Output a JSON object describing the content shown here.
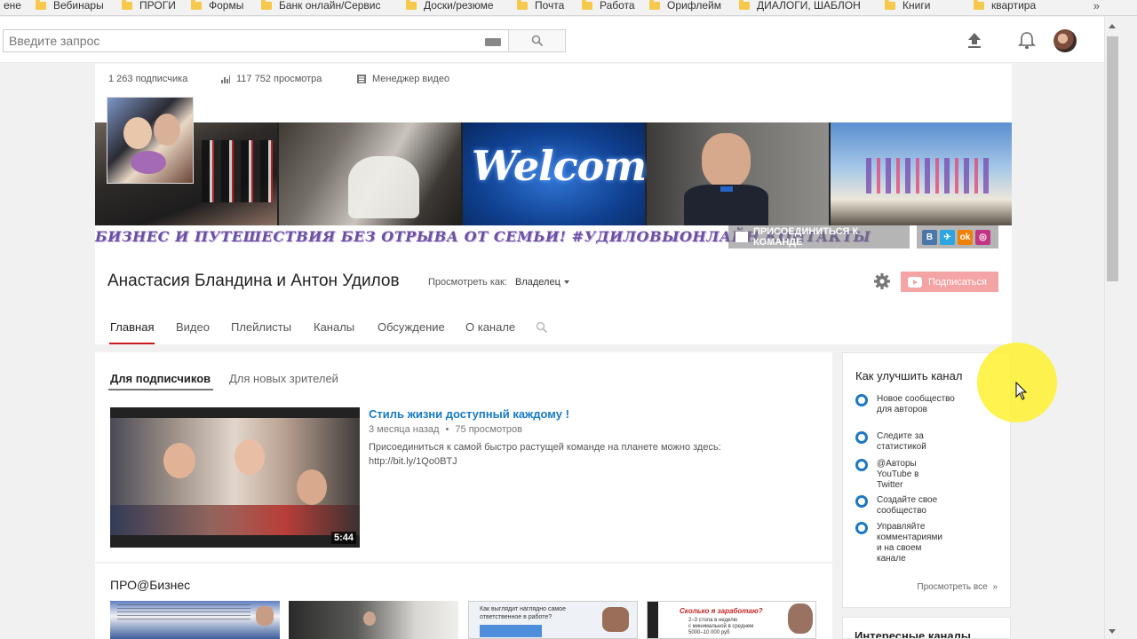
{
  "bookmarks": {
    "items": [
      "ене",
      "Вебинары",
      "ПРОГИ",
      "Формы",
      "Банк онлайн/Сервис",
      "Доски/резюме",
      "Почта",
      "Работа",
      "Орифлейм",
      "ДИАЛОГИ, ШАБЛОН",
      "Книги",
      "квартира"
    ],
    "more": "»"
  },
  "search": {
    "placeholder": "Введите запрос"
  },
  "channel": {
    "stats": {
      "subscribers": "1 263 подписчика",
      "views": "117 752 просмотра",
      "video_manager": "Менеджер видео"
    },
    "banner": {
      "welcome_text": "Welcome",
      "tagline": "БИЗНЕС  И ПУТЕШЕСТВИЯ БЕЗ ОТРЫВА ОТ СЕМЬИ! #УДИЛОВЫОНЛАЙН  КОНТАКТЫ",
      "join_link": "ПРИСОЕДИНИТЬСЯ К КОМАНДЕ",
      "social": [
        "В",
        "✈",
        "ok",
        "◎"
      ]
    },
    "title": "Анастасия Бландина и Антон Удилов",
    "view_as_label": "Просмотреть как:",
    "view_as_value": "Владелец",
    "subscribe_label": "Подписаться",
    "tabs": [
      "Главная",
      "Видео",
      "Плейлисты",
      "Каналы",
      "Обсуждение",
      "О канале"
    ]
  },
  "main": {
    "subtabs": [
      "Для подписчиков",
      "Для новых зрителей"
    ],
    "video": {
      "title": "Стиль жизни доступный каждому !",
      "age": "3 месяца назад",
      "views": "75 просмотров",
      "description": "Присоединиться к самой быстро растущей команде на планете можно здесь:",
      "link": "http://bit.ly/1Qo0BTJ",
      "duration": "5:44"
    },
    "section_title": "ПРО@Бизнес",
    "thumb_texts": [
      "Как выглядит наглядно самое ответственное в работе?",
      "Сколько я заработаю?",
      "2–3 стола в неделю",
      "с минимальной в среднем",
      "5000–10 000 руб"
    ]
  },
  "sidebar": {
    "title": "Как улучшить канал",
    "items": [
      "Новое сообщество для авторов",
      "Следите за статистикой",
      "@Авторы YouTube в Twitter",
      "Создайте свое сообщество",
      "Управляйте комментариями и на своем канале"
    ],
    "view_all": "Просмотреть все",
    "view_all_arrow": "»",
    "next_title": "Интересные каналы"
  },
  "colors": {
    "link": "#167ac6",
    "active_tab": "#cc181e",
    "subscribe": "#f4a4a4",
    "ring": "#1b78c5",
    "highlight": "#fff028"
  }
}
